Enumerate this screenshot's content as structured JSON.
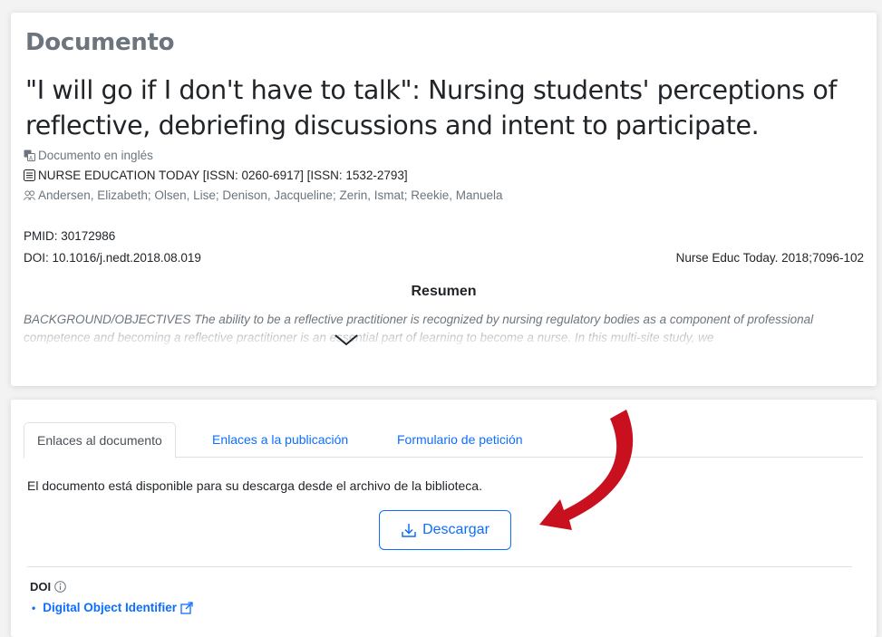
{
  "document": {
    "heading": "Documento",
    "title": "\"I will go if I don't have to talk\": Nursing students' perceptions of reflective, debriefing discussions and intent to participate.",
    "language": "Documento en inglés",
    "journal": "NURSE EDUCATION TODAY [ISSN: 0260-6917] [ISSN: 1532-2793]",
    "authors": "Andersen, Elizabeth; Olsen, Lise; Denison, Jacqueline; Zerin, Ismat; Reekie, Manuela",
    "pmid": "PMID: 30172986",
    "doi": "DOI: 10.1016/j.nedt.2018.08.019",
    "citation": "Nurse Educ Today. 2018;7096-102",
    "abstract_title": "Resumen",
    "abstract_lead": "BACKGROUND/OBJECTIVES",
    "abstract_text": "The ability to be a reflective practitioner is recognized by nursing regulatory bodies as a component of professional competence and becoming a reflective practitioner is an essential part of learning to become a nurse. In this multi-site study, we"
  },
  "links": {
    "tabs": [
      {
        "label": "Enlaces al documento",
        "active": true
      },
      {
        "label": "Enlaces a la publicación",
        "active": false
      },
      {
        "label": "Formulario de petición",
        "active": false
      }
    ],
    "availability_text": "El documento está disponible para su descarga desde el archivo de la biblioteca.",
    "download_label": "Descargar",
    "doi_label": "DOI",
    "doi_link": "Digital Object Identifier"
  },
  "colors": {
    "link": "#0d6efd",
    "muted": "#6c757d",
    "arrow": "#c8101e"
  },
  "icons": [
    "language-icon",
    "journal-icon",
    "authors-icon",
    "chevron-down-icon",
    "download-icon",
    "info-icon",
    "external-link-icon",
    "red-arrow"
  ]
}
